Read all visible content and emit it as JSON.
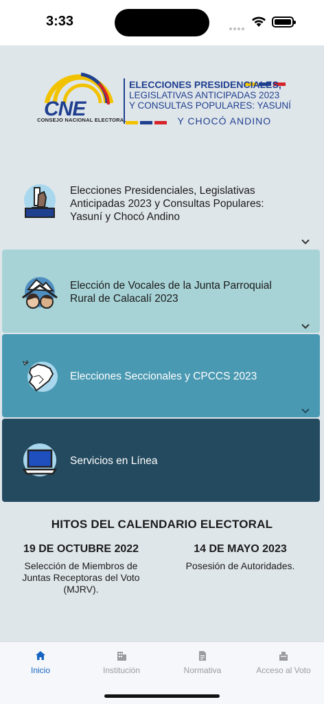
{
  "status_bar": {
    "time": "3:33"
  },
  "logo": {
    "acronym": "CNE",
    "org_name": "CONSEJO NACIONAL ELECTORAL",
    "line1": "ELECCIONES PRESIDENCIALES,",
    "line2": "LEGISLATIVAS ANTICIPADAS 2023",
    "line3": "Y CONSULTAS POPULARES: YASUNÍ",
    "line4": "Y CHOCÓ ANDINO"
  },
  "cards": [
    {
      "line1": "Elecciones Presidenciales, Legislativas",
      "line2": "Anticipadas 2023 y Consultas Populares:",
      "line3": "Yasuní y Chocó Andino",
      "icon": "ballot-box-icon"
    },
    {
      "line1": "Elección de Vocales de la Junta Parroquial",
      "line2": "Rural de Calacalí 2023",
      "icon": "community-icon"
    },
    {
      "line1": "Elecciones Seccionales y CPCCS 2023",
      "icon": "ecuador-map-icon"
    },
    {
      "line1": "Servicios en Línea",
      "icon": "laptop-icon"
    }
  ],
  "calendar": {
    "title": "HITOS DEL CALENDARIO ELECTORAL",
    "items": [
      {
        "date": "19 DE OCTUBRE 2022",
        "line1": "Selección de Miembros de",
        "line2": "Juntas Receptoras del Voto",
        "line3": "(MJRV)."
      },
      {
        "date": "14 DE MAYO 2023",
        "line1": "Posesión de Autoridades."
      }
    ]
  },
  "tabs": [
    {
      "label": "Inicio",
      "icon": "home-icon",
      "active": true
    },
    {
      "label": "Institución",
      "icon": "building-icon",
      "active": false
    },
    {
      "label": "Normativa",
      "icon": "document-icon",
      "active": false
    },
    {
      "label": "Acceso al Voto",
      "icon": "ballot-icon",
      "active": false
    }
  ],
  "colors": {
    "background": "#dfe6ea",
    "card2": "#a7d3d6",
    "card3": "#4a99b2",
    "card4": "#244a5f",
    "accent": "#1565c0",
    "brand_blue": "#1f3f8f"
  }
}
